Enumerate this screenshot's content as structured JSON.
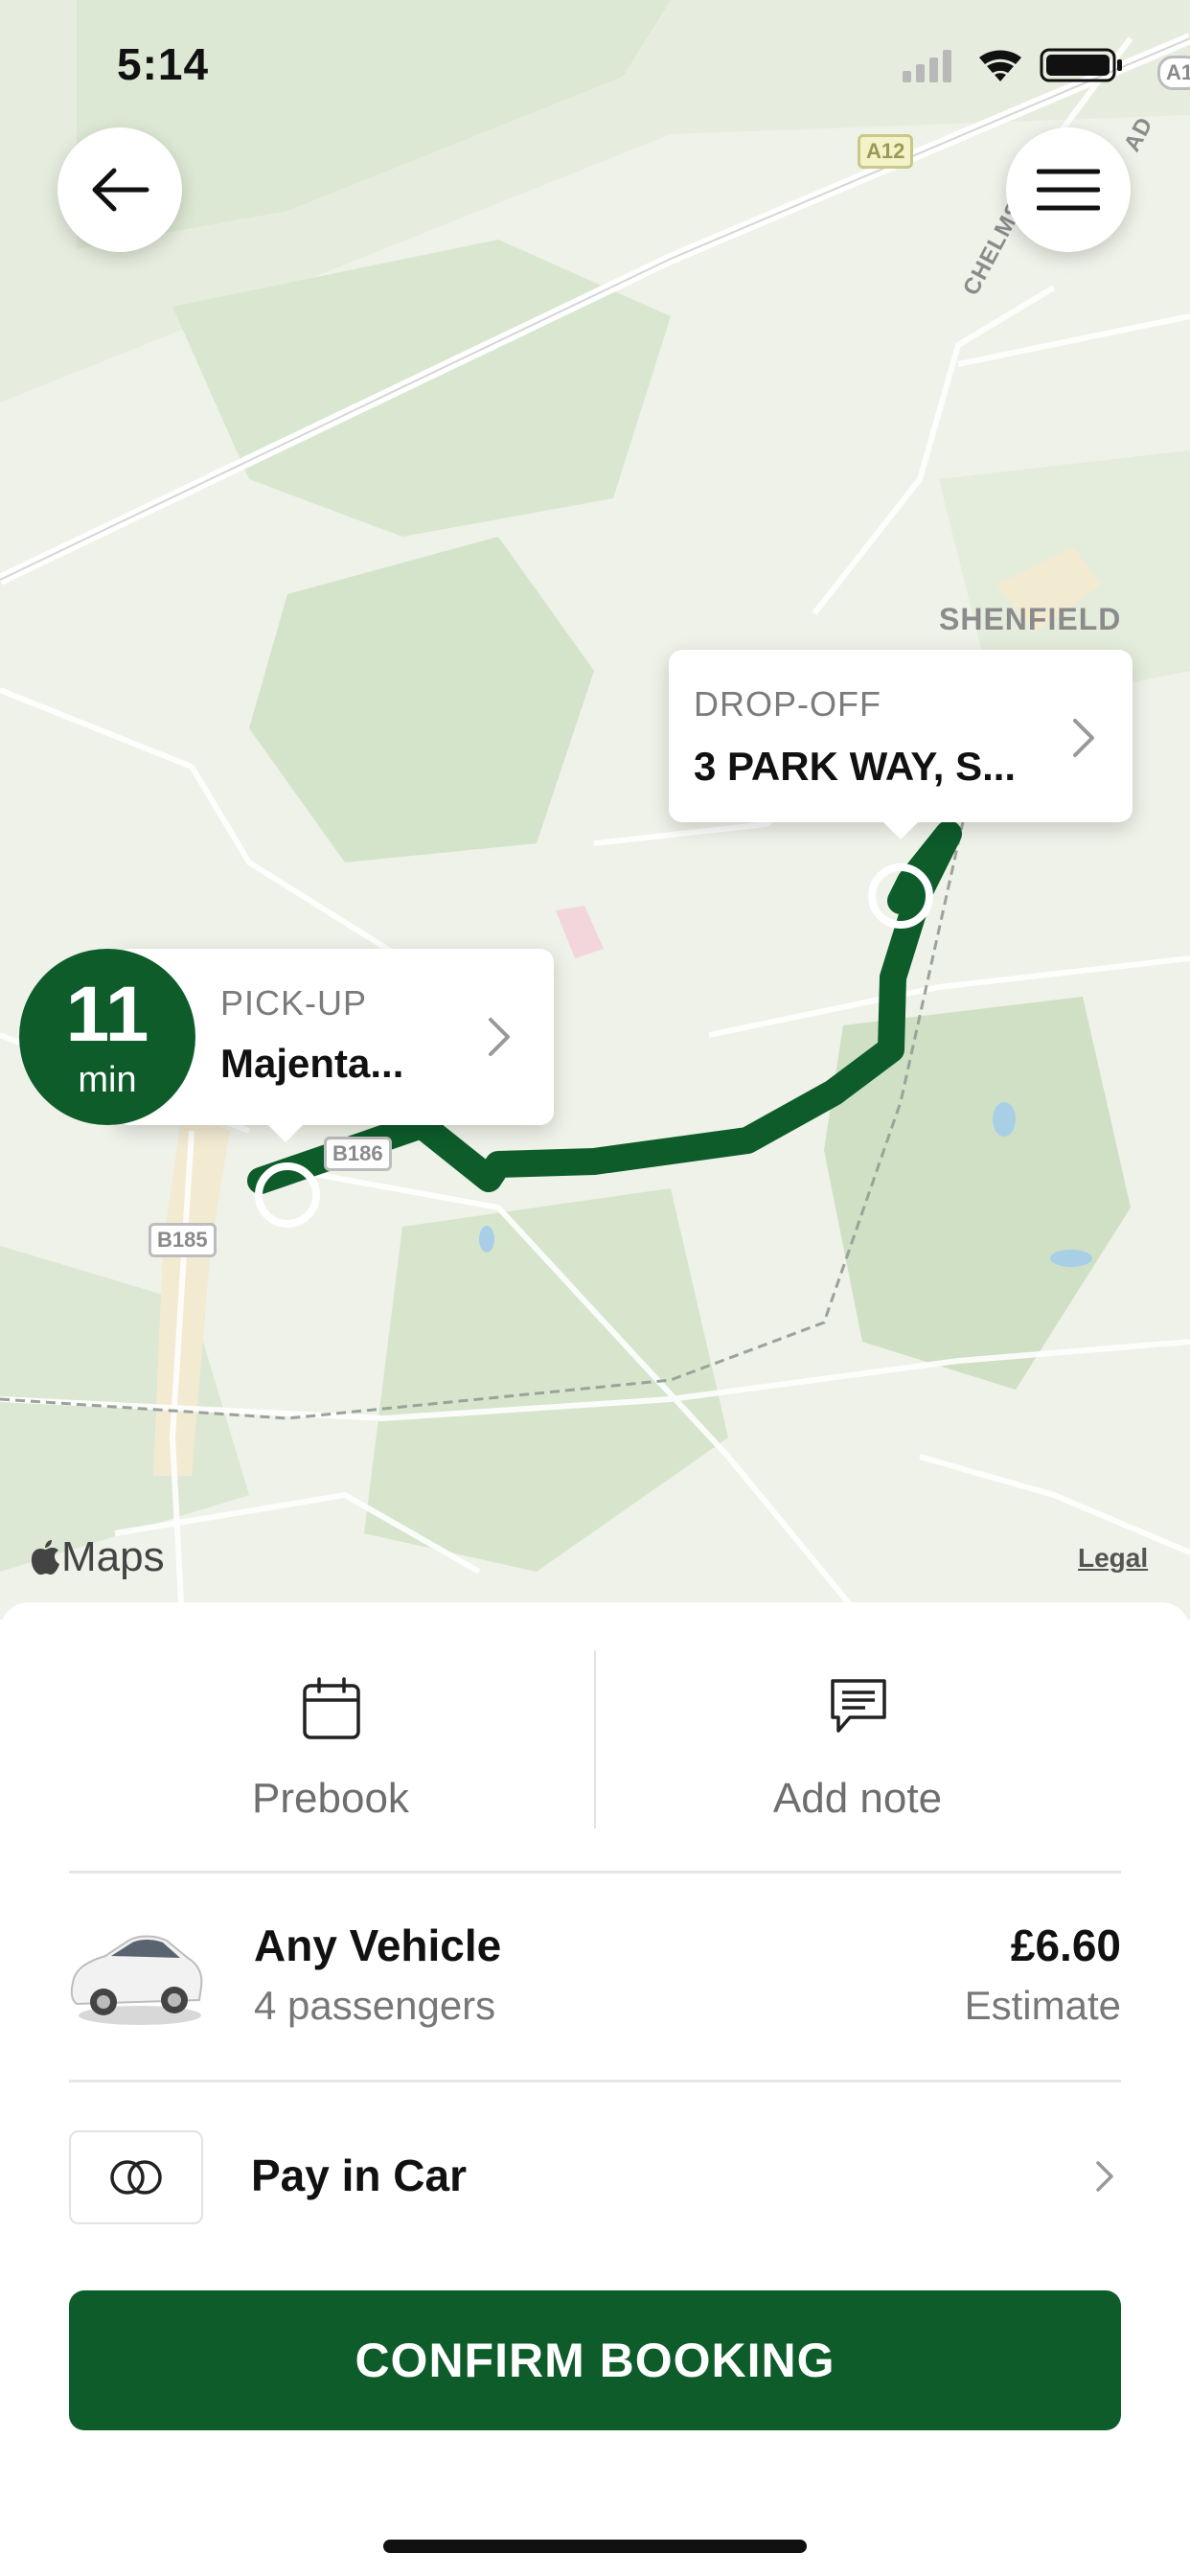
{
  "status_bar": {
    "time": "5:14"
  },
  "map": {
    "road_shields": [
      "A12",
      "B186",
      "B185"
    ],
    "place_labels": [
      "SHENFIELD"
    ],
    "street_label": "CHELMS",
    "street_label_end": "AD",
    "edge_shield": "A1",
    "brand": "Maps",
    "legal": "Legal",
    "route_color": "#0d5c2a"
  },
  "dropoff": {
    "label": "DROP-OFF",
    "value": "3 PARK WAY, S..."
  },
  "pickup": {
    "label": "PICK-UP",
    "value": "Majenta...",
    "eta_value": "11",
    "eta_unit": "min"
  },
  "actions": {
    "prebook": {
      "label": "Prebook",
      "icon": "calendar-icon"
    },
    "add_note": {
      "label": "Add note",
      "icon": "message-icon"
    }
  },
  "vehicle": {
    "name": "Any Vehicle",
    "passengers": "4 passengers",
    "price": "£6.60",
    "price_note": "Estimate"
  },
  "payment": {
    "label": "Pay in Car",
    "icon": "cash-icon"
  },
  "confirm_label": "CONFIRM BOOKING",
  "colors": {
    "brand_green": "#0d5c2a"
  }
}
